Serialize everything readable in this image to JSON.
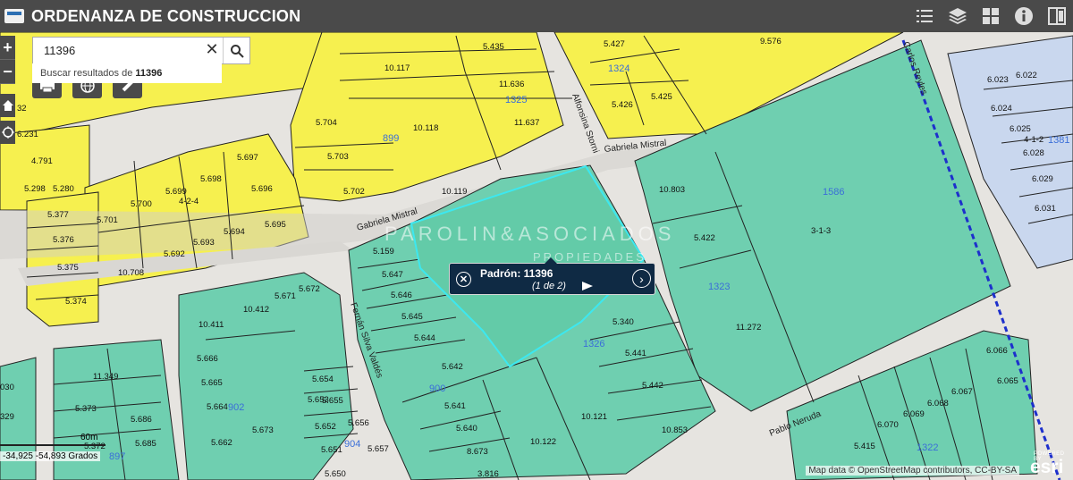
{
  "header": {
    "title": "ORDENANZA DE CONSTRUCCION",
    "icons": [
      "list-icon",
      "layers-icon",
      "grid-icon",
      "info-icon",
      "split-icon"
    ]
  },
  "search": {
    "value": "11396",
    "suggestion_prefix": "Buscar resultados de",
    "suggestion_term": "11396"
  },
  "zoom": {
    "in": "+",
    "out": "−"
  },
  "popup": {
    "title": "Padrón: 11396",
    "count": "(1 de 2)"
  },
  "watermark": {
    "line1": "PAROLIN&ASOCIADOS",
    "line2": "PROPIEDADES"
  },
  "scale": {
    "label": "60m"
  },
  "coordinates": "-34,925 -54,893 Grados",
  "attribution": "Map data © OpenStreetMap contributors, CC-BY-SA",
  "esri": {
    "powered": "POWERED BY",
    "name": "esri"
  },
  "colors": {
    "residential_zone": "#f6f04f",
    "green_zone": "#6fcfb0",
    "blue_zone": "#c9d7ee",
    "selected_outline": "#3ce8f0",
    "header": "#4a4a4a",
    "popup": "#0f2a44"
  },
  "streets": [
    "Gabriela Mistral",
    "Gabriela Mistral",
    "Alfonsina Storni",
    "Fernán Silva Valdés",
    "Pablo Neruda",
    "Carlos Reyles"
  ],
  "block_labels": [
    "1324",
    "1325",
    "899",
    "1586",
    "1323",
    "1326",
    "900",
    "902",
    "904",
    "897",
    "1322",
    "1381",
    "4-2-4",
    "3-1-3",
    "4-1-2"
  ],
  "parcel_labels": [
    "5.435",
    "5.427",
    "9.576",
    "10.117",
    "11.636",
    "11.637",
    "5.425",
    "5.426",
    "5.704",
    "5.703",
    "5.702",
    "10.118",
    "10.119",
    "6.231",
    "4.791",
    "5.298",
    "5.280",
    "5.697",
    "5.698",
    "5.699",
    "5.700",
    "5.701",
    "5.696",
    "5.695",
    "5.694",
    "5.693",
    "5.692",
    "5.377",
    "5.376",
    "5.375",
    "5.374",
    "10.708",
    "10.803",
    "5.422",
    "11.272",
    "5.159",
    "5.647",
    "5.646",
    "5.645",
    "5.644",
    "5.642",
    "5.340",
    "5.441",
    "5.442",
    "10.121",
    "10.853",
    "5.641",
    "5.640",
    "8.673",
    "10.122",
    "3.816",
    "5.672",
    "5.671",
    "10.412",
    "10.411",
    "5.666",
    "5.665",
    "5.664",
    "5.662",
    "5.673",
    "5.654",
    "5.655",
    "5.653",
    "5.656",
    "5.652",
    "5.657",
    "5.651",
    "5.650",
    "11.349",
    "5.373",
    "5.686",
    "5.685",
    "5.372",
    "6.023",
    "6.022",
    "6.024",
    "6.025",
    "6.028",
    "6.029",
    "6.031",
    "6.066",
    "6.065",
    "6.067",
    "6.068",
    "6.069",
    "6.070",
    "5.415",
    "32",
    "030",
    "329"
  ]
}
